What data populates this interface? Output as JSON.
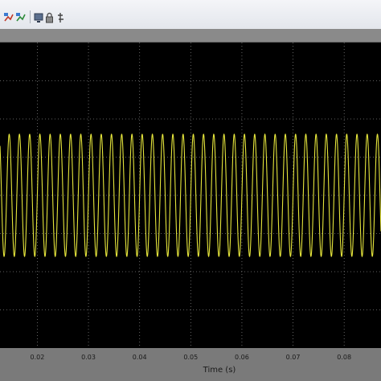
{
  "toolbar": {
    "buttons": [
      {
        "icon": "autoscale-x-icon"
      },
      {
        "icon": "autoscale-xy-icon"
      },
      {
        "icon": "save-axes-icon"
      },
      {
        "icon": "lock-icon"
      },
      {
        "icon": "scope-params-icon"
      }
    ]
  },
  "chart_data": {
    "type": "line",
    "title": "",
    "xlabel": "Time (s)",
    "ylabel": "",
    "x_ticks": [
      "0.02",
      "0.03",
      "0.04",
      "0.05",
      "0.06",
      "0.07",
      "0.08"
    ],
    "xlim": [
      0.0127,
      0.0872
    ],
    "ylim": [
      -2.5,
      2.5
    ],
    "grid": true,
    "background": "#000000",
    "series": [
      {
        "color": "#e6e63c",
        "waveform": "sine",
        "frequency_hz": 500,
        "amplitude": 1,
        "offset": 0
      }
    ]
  }
}
